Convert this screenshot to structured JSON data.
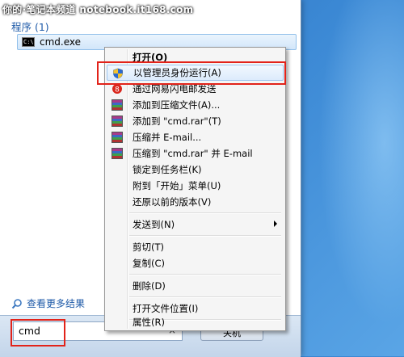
{
  "watermark": "你的·笔记本频道 notebook.it168.com",
  "start_menu": {
    "section_title": "程序 (1)",
    "result": {
      "label": "cmd.exe",
      "icon": "cmd-icon",
      "icon_text": "C:\\"
    },
    "more_results": "查看更多结果",
    "search": {
      "value": "cmd"
    },
    "clear_glyph": "×",
    "shutdown_label": "关机"
  },
  "context_menu": {
    "items": [
      {
        "label": "打开(O)",
        "bold": true
      },
      {
        "label": "以管理员身份运行(A)",
        "icon": "uac-shield-icon",
        "highlighted": true
      },
      {
        "label": "通过网易闪电邮发送",
        "icon": "netease-mail-icon"
      },
      {
        "label": "添加到压缩文件(A)...",
        "icon": "winrar-icon"
      },
      {
        "label": "添加到 \"cmd.rar\"(T)",
        "icon": "winrar-icon"
      },
      {
        "label": "压缩并 E-mail...",
        "icon": "winrar-icon"
      },
      {
        "label": "压缩到 \"cmd.rar\" 并 E-mail",
        "icon": "winrar-icon"
      },
      {
        "label": "锁定到任务栏(K)"
      },
      {
        "label": "附到「开始」菜单(U)"
      },
      {
        "label": "还原以前的版本(V)"
      },
      {
        "label": "发送到(N)",
        "submenu": true
      },
      {
        "label": "剪切(T)"
      },
      {
        "label": "复制(C)"
      },
      {
        "label": "删除(D)"
      },
      {
        "label": "打开文件位置(I)"
      },
      {
        "label": "属性(R)"
      }
    ]
  },
  "colors": {
    "highlight_box": "#e2231a",
    "link_blue": "#1e5aa8"
  }
}
